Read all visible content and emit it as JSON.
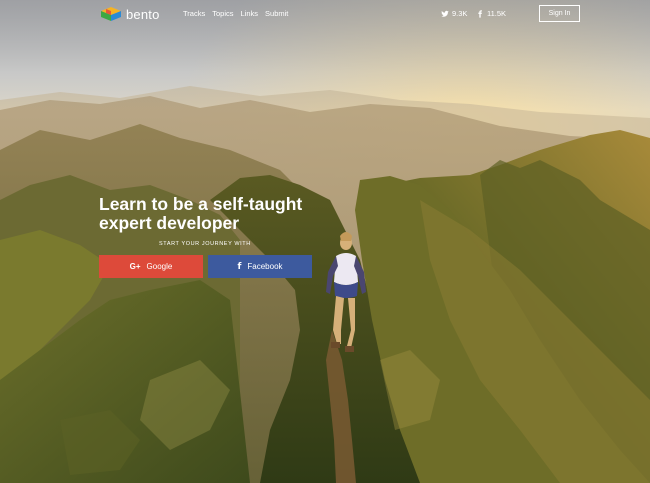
{
  "brand": {
    "name": "bento"
  },
  "nav": {
    "links": [
      "Tracks",
      "Topics",
      "Links",
      "Submit"
    ]
  },
  "social": {
    "twitter_count": "9.3K",
    "facebook_count": "11.5K"
  },
  "header": {
    "signin_label": "Sign In"
  },
  "hero": {
    "headline_line1": "Learn to be a self-taught",
    "headline_line2": "expert developer",
    "subline": "START YOUR JOURNEY WITH",
    "google_label": "Google",
    "facebook_label": "Facebook"
  },
  "icons": {
    "logo": "bento-cube-logo",
    "twitter": "twitter-icon",
    "facebook": "facebook-icon",
    "google": "google-plus-icon"
  },
  "colors": {
    "google": "#dd4a3a",
    "facebook": "#3d5a9e"
  }
}
